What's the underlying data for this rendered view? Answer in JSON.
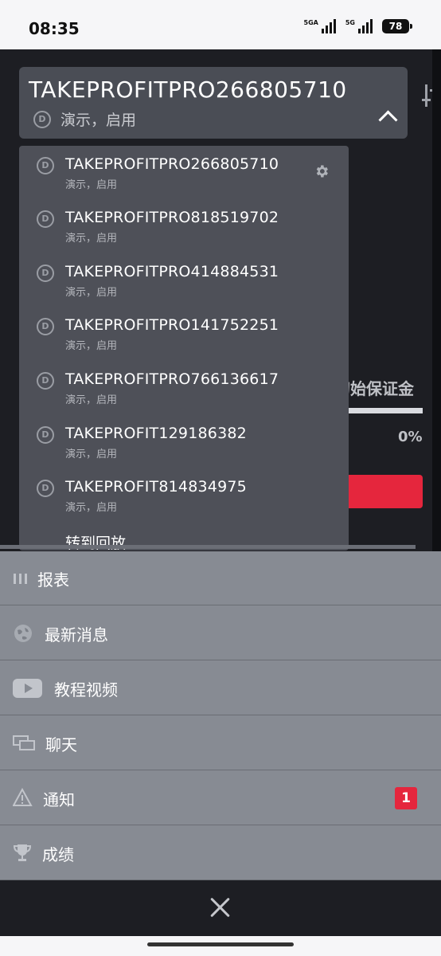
{
  "status_bar": {
    "time": "08:35",
    "network1": "5GA",
    "network2": "5G",
    "battery": "78"
  },
  "account": {
    "title": "TAKEPROFITPRO266805710",
    "subtitle": "演示，启用"
  },
  "background": {
    "margin_label": "初始保证金",
    "margin_percent": "0%"
  },
  "accounts": [
    {
      "name": "TAKEPROFITPRO266805710",
      "status": "演示，启用"
    },
    {
      "name": "TAKEPROFITPRO818519702",
      "status": "演示，启用"
    },
    {
      "name": "TAKEPROFITPRO414884531",
      "status": "演示，启用"
    },
    {
      "name": "TAKEPROFITPRO141752251",
      "status": "演示，启用"
    },
    {
      "name": "TAKEPROFITPRO766136617",
      "status": "演示，启用"
    },
    {
      "name": "TAKEPROFIT129186382",
      "status": "演示，启用"
    },
    {
      "name": "TAKEPROFIT814834975",
      "status": "演示，启用"
    }
  ],
  "replay_label": "转到回放",
  "menu": {
    "reports": "报表",
    "news": "最新消息",
    "tutorials": "教程视频",
    "chat": "聊天",
    "notifications": "通知",
    "notifications_count": "1",
    "achievements": "成绩"
  },
  "colors": {
    "accent_red": "#e5263d",
    "menu_bg": "#878b93",
    "dropdown_bg": "#4e5058"
  }
}
